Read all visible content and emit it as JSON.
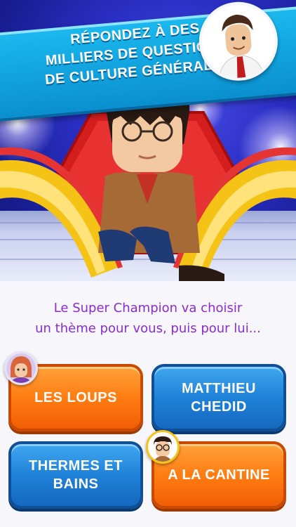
{
  "promo": {
    "headline_line1": "RÉPONDEZ À DES",
    "headline_line2": "MILLIERS DE QUESTIONS",
    "headline_line3": "DE CULTURE GÉNÉRALE !"
  },
  "game": {
    "prompt_line1": "Le Super Champion va choisir",
    "prompt_line2": "un thème pour vous, puis pour lui...",
    "themes": [
      {
        "line1": "LES LOUPS",
        "line2": "",
        "style": "orange"
      },
      {
        "line1": "MATTHIEU",
        "line2": "CHEDID",
        "style": "blue"
      },
      {
        "line1": "THERMES ET",
        "line2": "BAINS",
        "style": "blue"
      },
      {
        "line1": "A LA CANTINE",
        "line2": "",
        "style": "orange"
      }
    ]
  },
  "colors": {
    "prompt": "#8a2bd2",
    "orange_button": "#ff7d12",
    "blue_button": "#1f82d9",
    "banner": "#0a8fcf"
  }
}
